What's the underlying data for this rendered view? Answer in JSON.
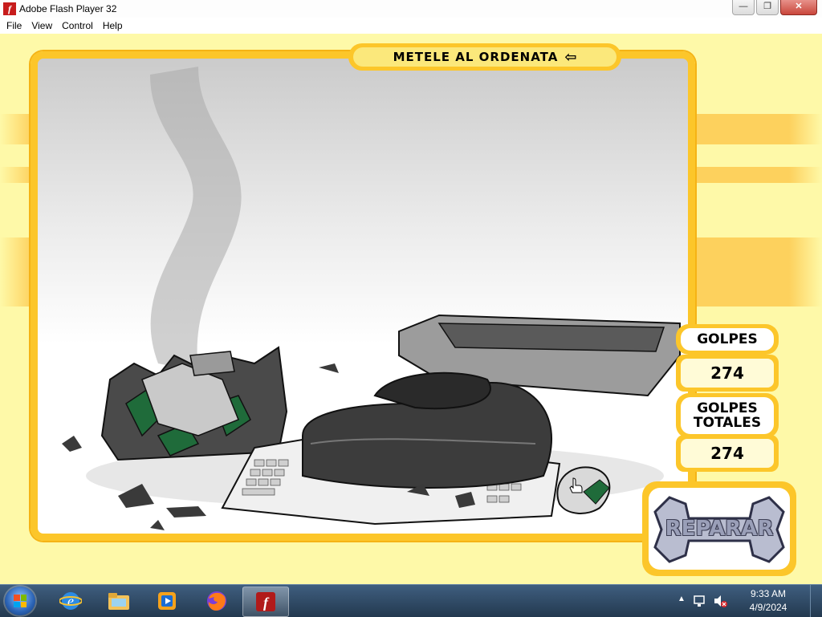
{
  "window": {
    "title": "Adobe Flash Player 32",
    "buttons": {
      "minimize": "—",
      "maximize": "❐",
      "close": "✕"
    }
  },
  "menu": [
    "File",
    "View",
    "Control",
    "Help"
  ],
  "game": {
    "title": "METELE AL ORDENATA",
    "title_icon": "back-arrow-icon",
    "counters": {
      "golpes_label": "GOLPES",
      "golpes_value": "274",
      "totales_label": "GOLPES TOTALES",
      "totales_value": "274"
    },
    "repair_label": "REPARAR",
    "colors": {
      "frame": "#fcc62a",
      "background": "#fef9a8",
      "stripe": "#fdd15d"
    }
  },
  "taskbar": {
    "apps": [
      "windows-start-icon",
      "internet-explorer-icon",
      "file-explorer-icon",
      "media-player-icon",
      "firefox-icon",
      "flash-player-icon"
    ],
    "time": "9:33 AM",
    "date": "4/9/2024"
  }
}
